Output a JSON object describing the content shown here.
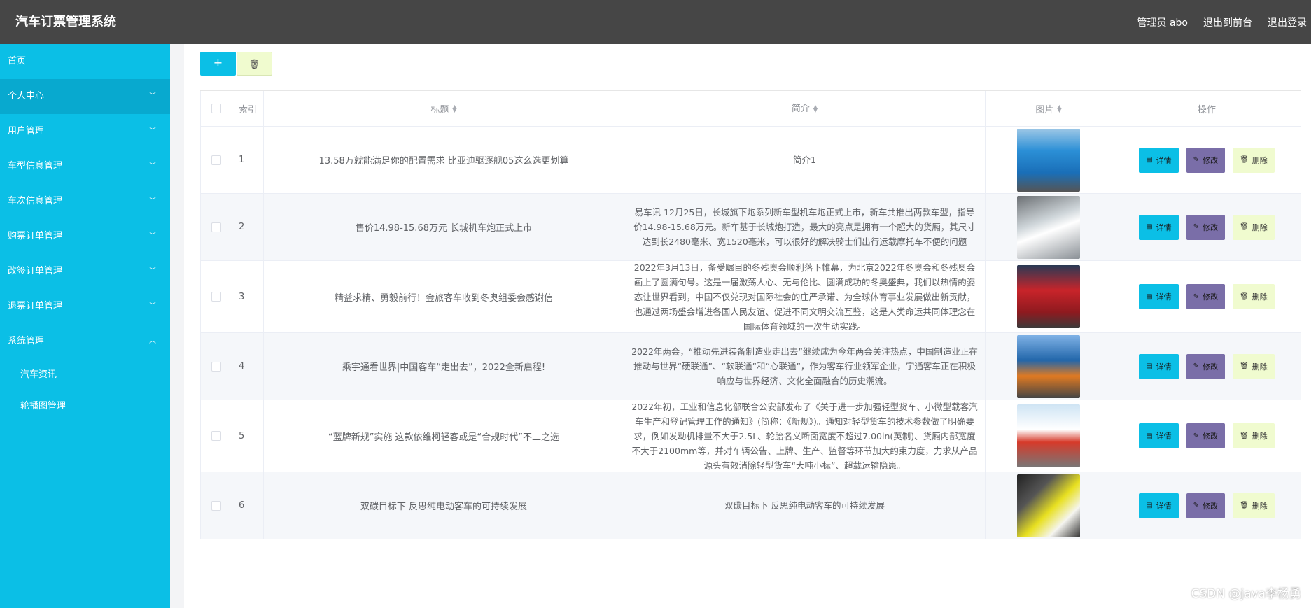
{
  "header": {
    "title": "汽车订票管理系统",
    "admin_label": "管理员 abo",
    "front_link": "退出到前台",
    "logout_link": "退出登录"
  },
  "sidebar": {
    "items": [
      {
        "label": "首页",
        "icon": ""
      },
      {
        "label": "个人中心",
        "icon": "chevron-down"
      },
      {
        "label": "用户管理",
        "icon": "chevron-down"
      },
      {
        "label": "车型信息管理",
        "icon": "chevron-down"
      },
      {
        "label": "车次信息管理",
        "icon": "chevron-down"
      },
      {
        "label": "购票订单管理",
        "icon": "chevron-down"
      },
      {
        "label": "改签订单管理",
        "icon": "chevron-down"
      },
      {
        "label": "退票订单管理",
        "icon": "chevron-down"
      },
      {
        "label": "系统管理",
        "icon": "chevron-up"
      }
    ],
    "sub_items": [
      {
        "label": "汽车资讯"
      },
      {
        "label": "轮播图管理"
      }
    ]
  },
  "toolbar": {
    "add_label": "+",
    "delete_label": "🗑"
  },
  "table": {
    "columns": [
      "索引",
      "标题",
      "简介",
      "图片",
      "操作"
    ],
    "buttons": {
      "detail": "详情",
      "edit": "修改",
      "delete": "删除"
    },
    "rows": [
      {
        "index": "1",
        "title": "13.58万就能满足你的配置需求 比亚迪驱逐舰05这么选更划算",
        "intro": "简介1",
        "image": "blue-bus"
      },
      {
        "index": "2",
        "title": "售价14.98-15.68万元 长城机车炮正式上市",
        "intro": "易车讯 12月25日，长城旗下炮系列新车型机车炮正式上市，新车共推出两款车型，指导价14.98-15.68万元。新车基于长城炮打造，最大的亮点是拥有一个超大的货厢，其尺寸达到长2480毫米、宽1520毫米，可以很好的解决骑士们出行运载摩托车不便的问题",
        "image": "train"
      },
      {
        "index": "3",
        "title": "精益求精、勇毅前行！金旅客车收到冬奥组委会感谢信",
        "intro": "2022年3月13日，备受瞩目的冬残奥会顺利落下帷幕，为北京2022年冬奥会和冬残奥会画上了圆满句号。这是一届激荡人心、无与伦比、圆满成功的冬奥盛典，我们以热情的姿态让世界看到，中国不仅兑现对国际社会的庄严承诺、为全球体育事业发展做出新贡献，也通过两场盛会增进各国人民友谊、促进不同文明交流互鉴，这是人类命运共同体理念在国际体育领域的一次生动实践。",
        "image": "red-bus"
      },
      {
        "index": "4",
        "title": "乘宇通看世界|中国客车“走出去”，2022全新启程!",
        "intro": "2022年两会，“推动先进装备制造业走出去”继续成为今年两会关注热点，中国制造业正在推动与世界“硬联通”、“软联通”和“心联通”，作为客车行业领军企业，宇通客车正在积极响应与世界经济、文化全面融合的历史潮流。",
        "image": "bus-fleet"
      },
      {
        "index": "5",
        "title": "“蓝牌新规”实施 这款依维柯轻客或是“合规时代”不二之选",
        "intro": "2022年初，工业和信息化部联合公安部发布了《关于进一步加强轻型货车、小微型载客汽车生产和登记管理工作的通知》(简称：《新规》)。通知对轻型货车的技术参数做了明确要求，例如发动机排量不大于2.5L、轮胎名义断面宽度不超过7.00in(英制)、货厢内部宽度不大于2100mm等，并对车辆公告、上牌、生产、监督等环节加大约束力度，力求从产品源头有效消除轻型货车“大吨小标”、超载运输隐患。",
        "image": "bus-row"
      },
      {
        "index": "6",
        "title": "双碳目标下 反思纯电动客车的可持续发展",
        "intro": "双碳目标下 反思纯电动客车的可持续发展",
        "image": "yellow-train"
      }
    ]
  },
  "watermark": "CSDN @java李杨勇"
}
